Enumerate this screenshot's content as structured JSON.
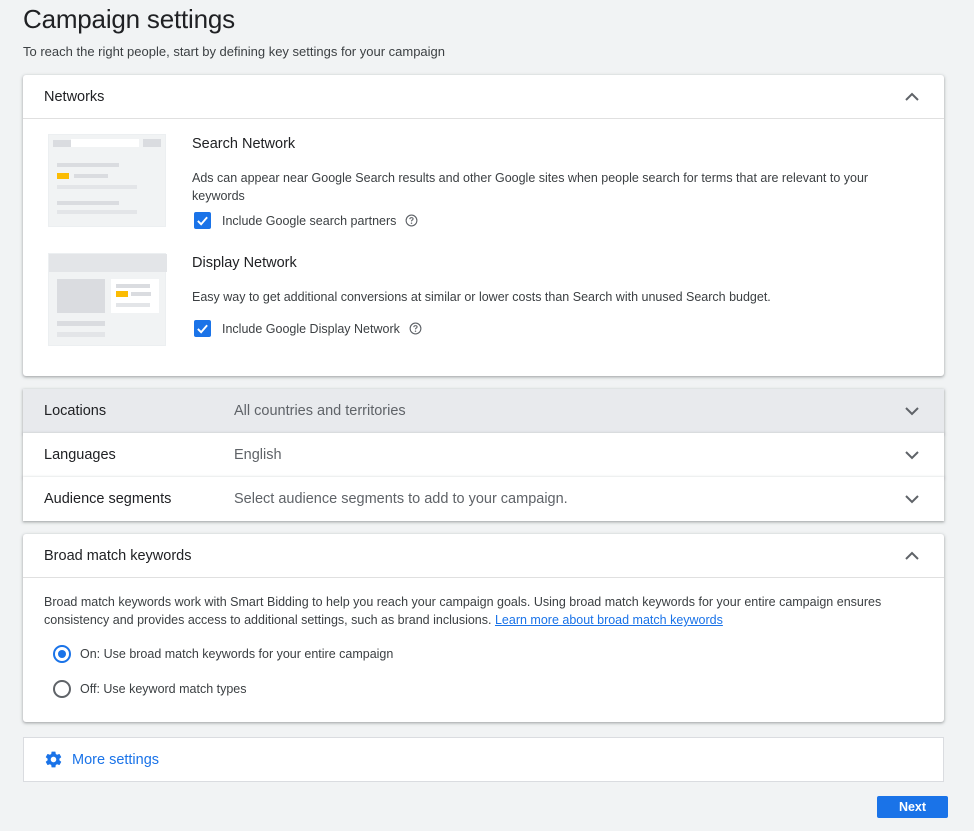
{
  "page": {
    "title": "Campaign settings",
    "subtitle": "To reach the right people, start by defining key settings for your campaign"
  },
  "networks": {
    "title": "Networks",
    "search": {
      "title": "Search Network",
      "description": "Ads can appear near Google Search results and other Google sites when people search for terms that are relevant to your keywords",
      "checkbox_label": "Include Google search partners",
      "checked": true
    },
    "display": {
      "title": "Display Network",
      "description": "Easy way to get additional conversions at similar or lower costs than Search with unused Search budget.",
      "checkbox_label": "Include Google Display Network",
      "checked": true
    }
  },
  "locations": {
    "label": "Locations",
    "value": "All countries and territories"
  },
  "languages": {
    "label": "Languages",
    "value": "English"
  },
  "audience": {
    "label": "Audience segments",
    "value": "Select audience segments to add to your campaign."
  },
  "broad_match": {
    "title": "Broad match keywords",
    "description": "Broad match keywords work with Smart Bidding to help you reach your campaign goals. Using broad match keywords for your entire campaign ensures consistency and provides access to additional settings, such as brand inclusions.",
    "link_text": "Learn more about broad match keywords",
    "option_on": "On: Use broad match keywords for your entire campaign",
    "option_off": "Off: Use keyword match types",
    "selected": "on"
  },
  "more_settings": {
    "label": "More settings"
  },
  "footer": {
    "next_label": "Next"
  },
  "colors": {
    "accent": "#1a73e8",
    "illus_yellow": "#fbbc04"
  }
}
